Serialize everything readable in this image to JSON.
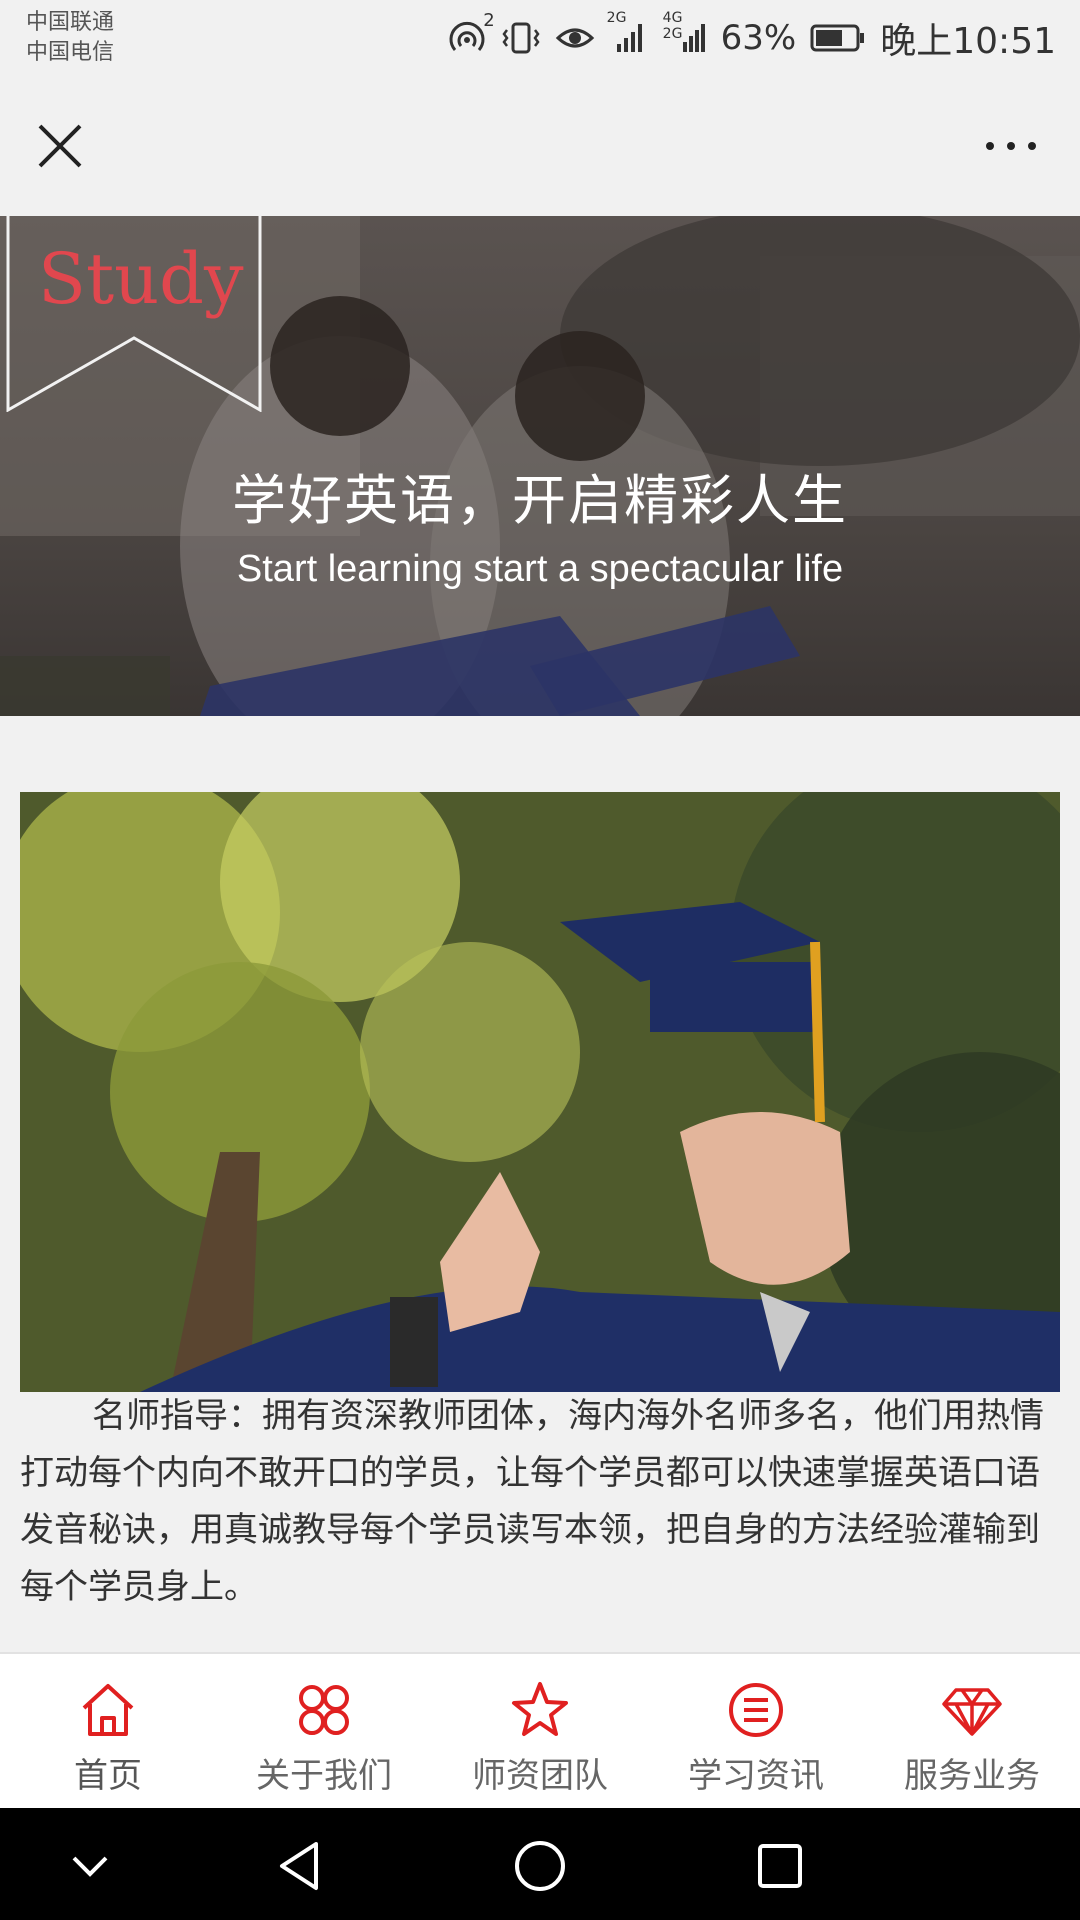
{
  "status_bar": {
    "carrier_1": "中国联通",
    "carrier_2": "中国电信",
    "hotspot_badge": "2",
    "signal_1": "2G",
    "signal_2_top": "4G",
    "signal_2_bottom": "2G",
    "battery_percent": "63%",
    "time": "晚上10:51"
  },
  "title_bar": {
    "close_icon": "close-icon",
    "more_icon": "more-dots-icon"
  },
  "hero": {
    "tag": "Study",
    "title": "学好英语，开启精彩人生",
    "subtitle": "Start learning start a spectacular life"
  },
  "article": {
    "description": "名师指导：拥有资深教师团体，海内海外名师多名，他们用热情打动每个内向不敢开口的学员，让每个学员都可以快速掌握英语口语发音秘诀，用真诚教导每个学员读写本领，把自身的方法经验灌输到每个学员身上。"
  },
  "tabs": [
    {
      "label": "首页",
      "icon": "home-icon"
    },
    {
      "label": "关于我们",
      "icon": "grid-icon"
    },
    {
      "label": "师资团队",
      "icon": "star-icon"
    },
    {
      "label": "学习资讯",
      "icon": "list-icon"
    },
    {
      "label": "服务业务",
      "icon": "diamond-icon"
    }
  ],
  "colors": {
    "accent": "#e02020",
    "tab_label": "#666666"
  }
}
